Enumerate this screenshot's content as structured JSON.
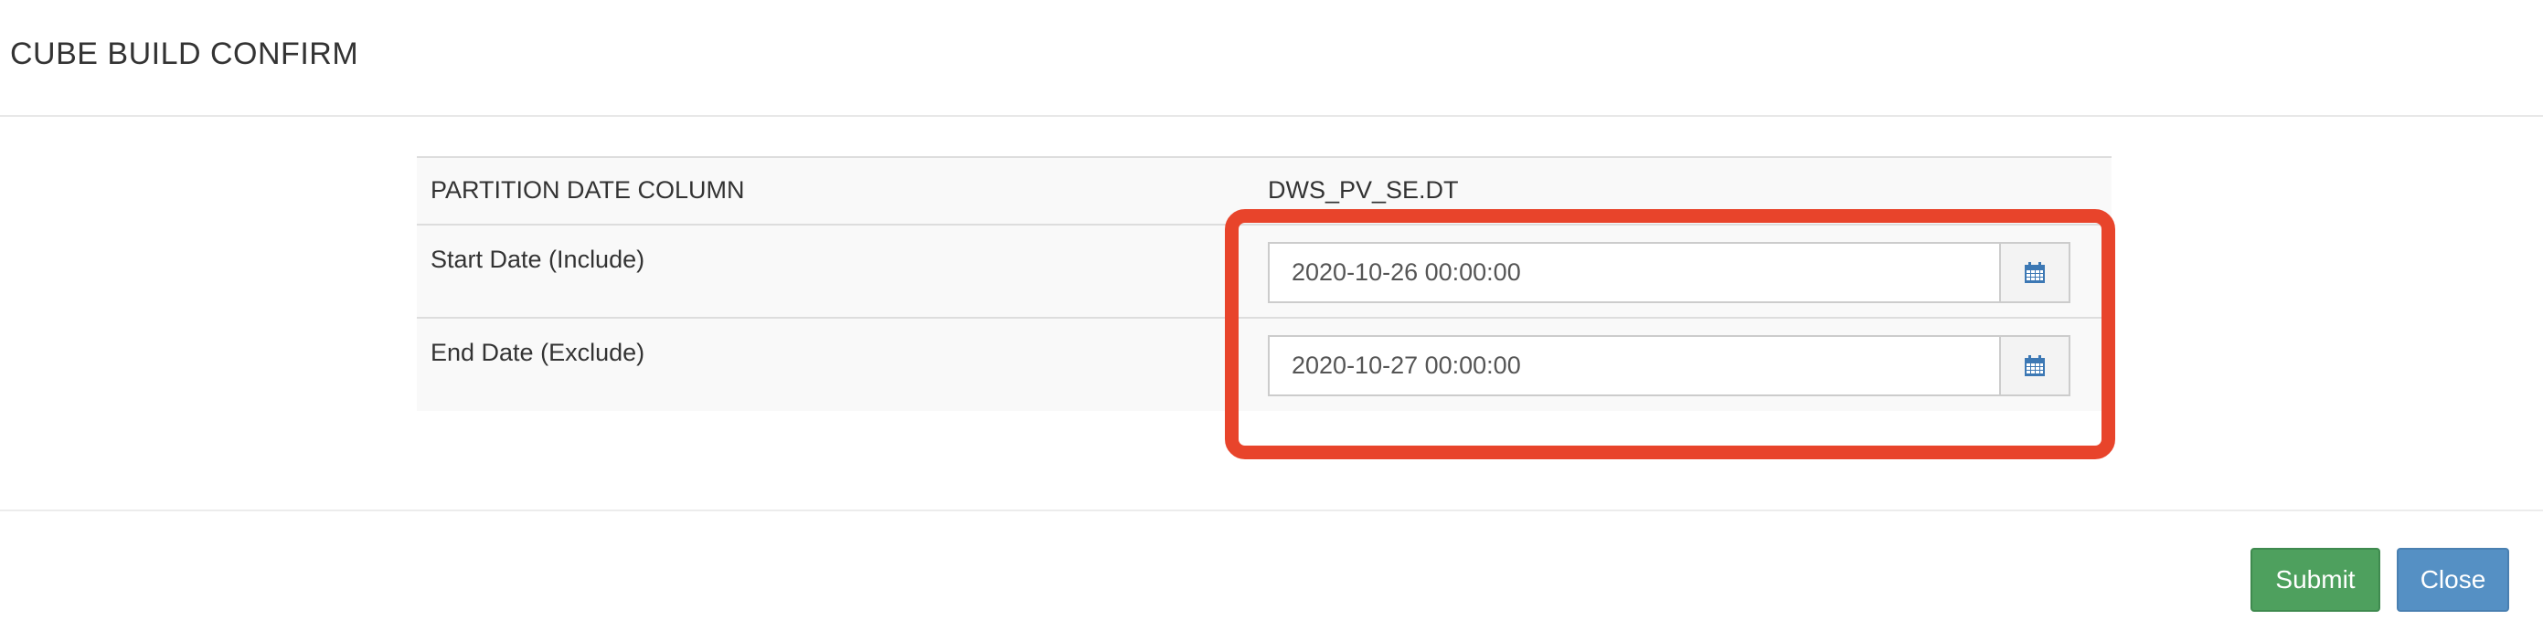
{
  "modal": {
    "title": "CUBE BUILD CONFIRM"
  },
  "table": {
    "partition_label": "PARTITION DATE COLUMN",
    "partition_value": "DWS_PV_SE.DT",
    "start_label": "Start Date (Include)",
    "start_value": "2020-10-26 00:00:00",
    "end_label": "End Date (Exclude)",
    "end_value": "2020-10-27 00:00:00",
    "calendar_icon": "calendar-icon"
  },
  "footer": {
    "submit_label": "Submit",
    "close_label": "Close"
  },
  "colors": {
    "highlight": "#e8442b",
    "submit": "#4ea05e",
    "close": "#5590c4",
    "calendar_icon": "#3c78b4"
  }
}
